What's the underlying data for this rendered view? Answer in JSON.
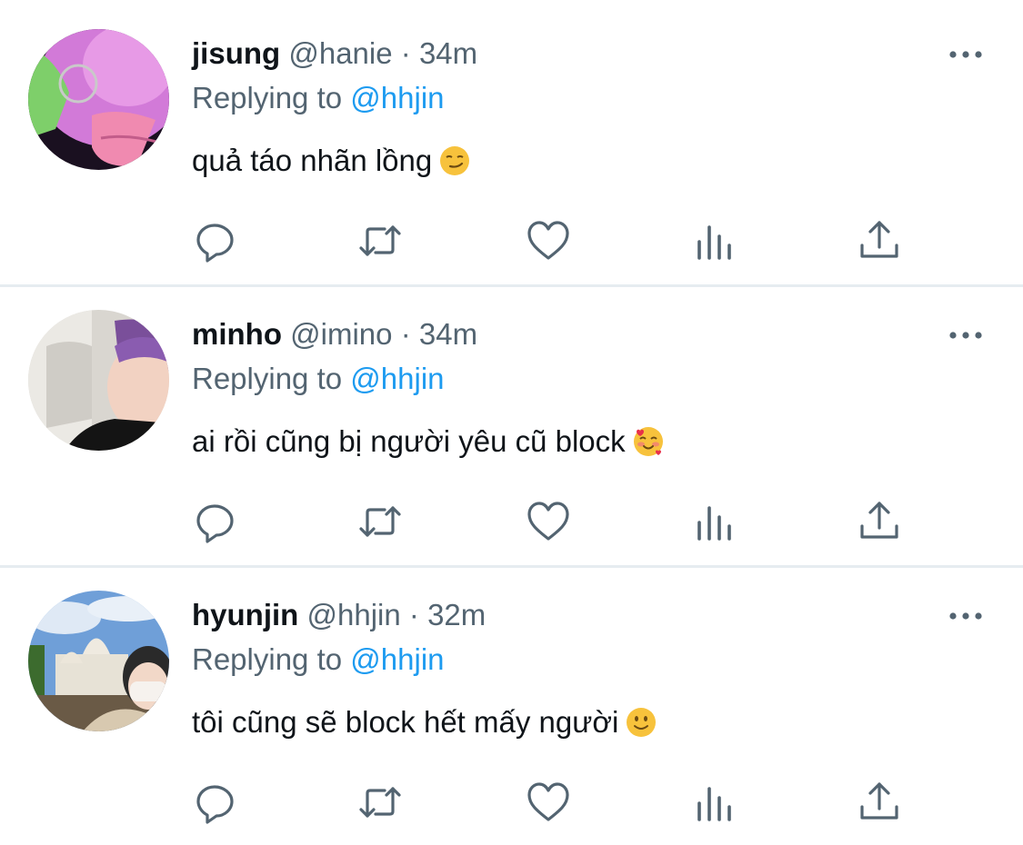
{
  "tweets": [
    {
      "name": "jisung",
      "handle": "@hanie",
      "separator": "·",
      "time": "34m",
      "replying_prefix": "Replying to",
      "replying_to": "@hhjin",
      "text": "quả táo nhãn lồng",
      "emoji": "smirking-face",
      "avatar": "avatar-purple-lit-selfie"
    },
    {
      "name": "minho",
      "handle": "@imino",
      "separator": "·",
      "time": "34m",
      "replying_prefix": "Replying to",
      "replying_to": "@hhjin",
      "text": "ai rồi cũng bị người yêu cũ block",
      "emoji": "smiling-face-with-hearts",
      "avatar": "avatar-purple-hair-selfie"
    },
    {
      "name": "hyunjin",
      "handle": "@hhjin",
      "separator": "·",
      "time": "32m",
      "replying_prefix": "Replying to",
      "replying_to": "@hhjin",
      "text": "tôi cũng sẽ block hết mấy người",
      "emoji": "slightly-smiling-face",
      "avatar": "avatar-basilica-selfie"
    }
  ],
  "icons": {
    "more": "more-dots-icon",
    "reply": "reply-bubble-icon",
    "retweet": "retweet-icon",
    "like": "heart-icon",
    "views": "views-chart-icon",
    "share": "share-upload-icon"
  },
  "colors": {
    "text": "#0f1419",
    "secondary": "#536471",
    "accent": "#1d9bf0",
    "divider": "#e6ecf0"
  }
}
